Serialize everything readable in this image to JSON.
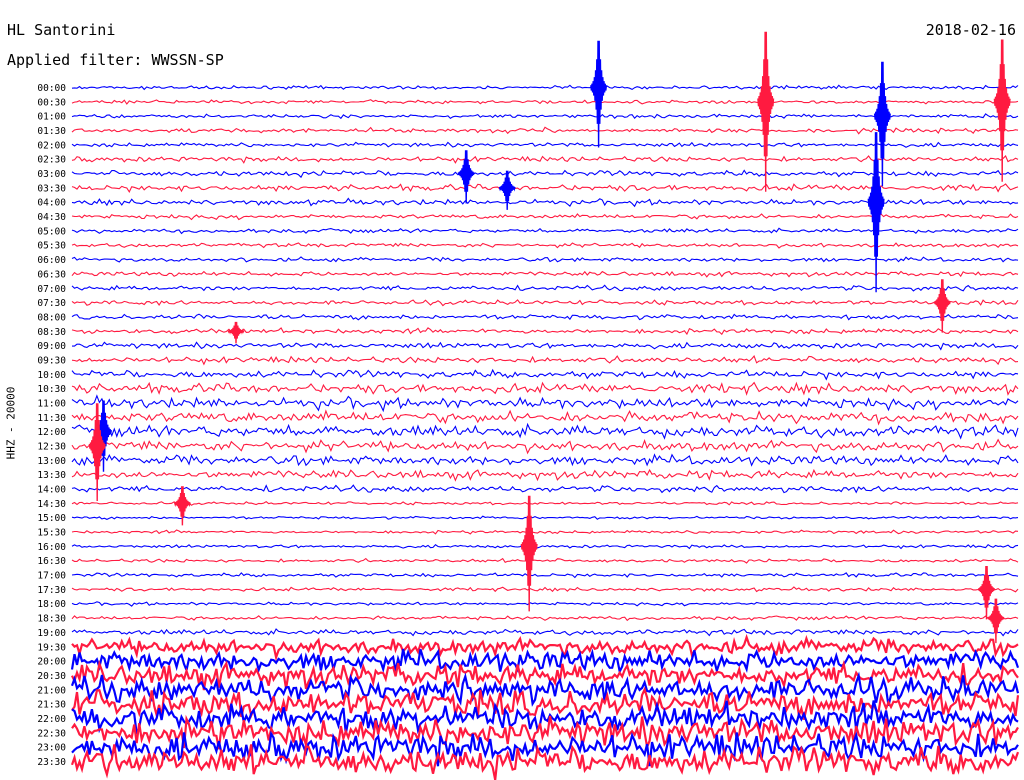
{
  "header": {
    "station": "HL Santorini",
    "filter": "Applied filter: WWSSN-SP",
    "date": "2018-02-16"
  },
  "colors": {
    "even_trace": "#0000ff",
    "odd_trace": "#ff1a40",
    "background": "#ffffff"
  },
  "chart_data": {
    "type": "line",
    "title": "HL Santorini",
    "subtitle": "Applied filter: WWSSN-SP",
    "ylabel": "HHZ - 20000",
    "xlabel": "",
    "trace_minutes": 30,
    "series_colors": [
      "#0000ff",
      "#ff1a40"
    ],
    "rows": [
      {
        "label": "00:00",
        "noise": 1.0
      },
      {
        "label": "00:30",
        "noise": 1.0
      },
      {
        "label": "01:00",
        "noise": 1.1
      },
      {
        "label": "01:30",
        "noise": 1.3
      },
      {
        "label": "02:00",
        "noise": 1.2
      },
      {
        "label": "02:30",
        "noise": 1.5
      },
      {
        "label": "03:00",
        "noise": 1.6
      },
      {
        "label": "03:30",
        "noise": 1.8
      },
      {
        "label": "04:00",
        "noise": 1.6
      },
      {
        "label": "04:30",
        "noise": 1.3
      },
      {
        "label": "05:00",
        "noise": 1.2
      },
      {
        "label": "05:30",
        "noise": 1.2
      },
      {
        "label": "06:00",
        "noise": 1.2
      },
      {
        "label": "06:30",
        "noise": 1.3
      },
      {
        "label": "07:00",
        "noise": 1.4
      },
      {
        "label": "07:30",
        "noise": 1.3
      },
      {
        "label": "08:00",
        "noise": 1.4
      },
      {
        "label": "08:30",
        "noise": 1.5
      },
      {
        "label": "09:00",
        "noise": 1.6
      },
      {
        "label": "09:30",
        "noise": 1.8
      },
      {
        "label": "10:00",
        "noise": 2.2
      },
      {
        "label": "10:30",
        "noise": 2.8
      },
      {
        "label": "11:00",
        "noise": 3.0
      },
      {
        "label": "11:30",
        "noise": 3.2
      },
      {
        "label": "12:00",
        "noise": 3.4
      },
      {
        "label": "12:30",
        "noise": 3.0
      },
      {
        "label": "13:00",
        "noise": 2.8
      },
      {
        "label": "13:30",
        "noise": 2.5
      },
      {
        "label": "14:00",
        "noise": 1.8
      },
      {
        "label": "14:30",
        "noise": 0.8
      },
      {
        "label": "15:00",
        "noise": 0.8
      },
      {
        "label": "15:30",
        "noise": 0.9
      },
      {
        "label": "16:00",
        "noise": 0.9
      },
      {
        "label": "16:30",
        "noise": 1.0
      },
      {
        "label": "17:00",
        "noise": 1.1
      },
      {
        "label": "17:30",
        "noise": 1.0
      },
      {
        "label": "18:00",
        "noise": 0.9
      },
      {
        "label": "18:30",
        "noise": 1.1
      },
      {
        "label": "19:00",
        "noise": 1.6
      },
      {
        "label": "19:30",
        "noise": 4.5
      },
      {
        "label": "20:00",
        "noise": 6.0
      },
      {
        "label": "20:30",
        "noise": 6.5
      },
      {
        "label": "21:00",
        "noise": 7.0
      },
      {
        "label": "21:30",
        "noise": 7.5
      },
      {
        "label": "22:00",
        "noise": 8.0
      },
      {
        "label": "22:30",
        "noise": 8.0
      },
      {
        "label": "23:00",
        "noise": 8.0
      },
      {
        "label": "23:30",
        "noise": 8.0
      }
    ],
    "events": [
      {
        "row": 0,
        "minute": 16.7,
        "amp": 60,
        "color": "#0000ff"
      },
      {
        "row": 1,
        "minute": 22.0,
        "amp": 90,
        "color": "#ff1a40"
      },
      {
        "row": 1,
        "minute": 29.5,
        "amp": 80,
        "color": "#ff1a40"
      },
      {
        "row": 2,
        "minute": 25.7,
        "amp": 70,
        "color": "#0000ff"
      },
      {
        "row": 6,
        "minute": 12.5,
        "amp": 30,
        "color": "#0000ff"
      },
      {
        "row": 7,
        "minute": 13.8,
        "amp": 22,
        "color": "#0000ff"
      },
      {
        "row": 8,
        "minute": 25.5,
        "amp": 90,
        "color": "#0000ff"
      },
      {
        "row": 15,
        "minute": 27.6,
        "amp": 30,
        "color": "#ff1a40"
      },
      {
        "row": 17,
        "minute": 5.2,
        "amp": 12,
        "color": "#ff1a40"
      },
      {
        "row": 24,
        "minute": 1.0,
        "amp": 40,
        "color": "#0000ff"
      },
      {
        "row": 25,
        "minute": 0.8,
        "amp": 55,
        "color": "#ff1a40"
      },
      {
        "row": 29,
        "minute": 3.5,
        "amp": 22,
        "color": "#ff1a40"
      },
      {
        "row": 32,
        "minute": 14.5,
        "amp": 65,
        "color": "#ff1a40"
      },
      {
        "row": 35,
        "minute": 29.0,
        "amp": 30,
        "color": "#ff1a40"
      },
      {
        "row": 37,
        "minute": 29.3,
        "amp": 25,
        "color": "#ff1a40"
      }
    ]
  }
}
